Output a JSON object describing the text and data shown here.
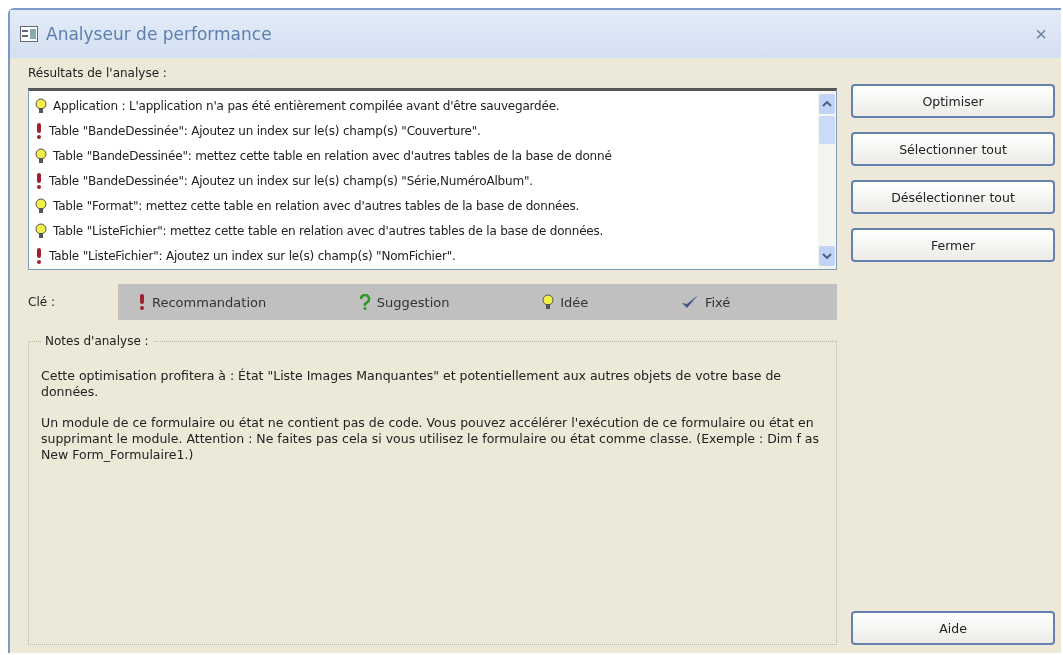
{
  "window": {
    "title": "Analyseur de performance",
    "close": "×"
  },
  "results": {
    "label": "Résultats de l'analyse :",
    "items": [
      {
        "kind": "idea",
        "text": "Application : L'application n'a pas été entièrement compilée avant d'être sauvegardée."
      },
      {
        "kind": "recommendation",
        "text": "Table \"BandeDessinée\": Ajoutez un index sur le(s) champ(s) \"Couverture\"."
      },
      {
        "kind": "idea",
        "text": "Table \"BandeDessinée\": mettez cette table en relation avec d'autres tables de la base de donné"
      },
      {
        "kind": "recommendation",
        "text": "Table \"BandeDessinée\": Ajoutez un index sur le(s) champ(s) \"Série,NuméroAlbum\"."
      },
      {
        "kind": "idea",
        "text": "Table \"Format\": mettez cette table en relation avec d'autres tables de la base de données."
      },
      {
        "kind": "idea",
        "text": "Table \"ListeFichier\": mettez cette table en relation avec d'autres tables de la base de données."
      },
      {
        "kind": "recommendation",
        "text": "Table \"ListeFichier\": Ajoutez un index sur le(s) champ(s) \"NomFichier\"."
      }
    ]
  },
  "key": {
    "label": "Clé :",
    "entries": [
      {
        "kind": "recommendation",
        "text": "Recommandation"
      },
      {
        "kind": "suggestion",
        "text": "Suggestion"
      },
      {
        "kind": "idea",
        "text": "Idée"
      },
      {
        "kind": "fixed",
        "text": "Fixé"
      }
    ]
  },
  "notes": {
    "label": "Notes d'analyse :",
    "paragraphs": [
      "Cette optimisation profitera à : État \"Liste Images Manquantes\" et potentiellement aux autres objets de votre base de données.",
      "Un module de ce formulaire ou état ne contient pas de code. Vous pouvez accélérer l'exécution de ce formulaire ou état en supprimant le module. Attention : Ne faites pas cela si vous utilisez le formulaire ou état comme classe. (Exemple : Dim f as New Form_Formulaire1.)"
    ]
  },
  "buttons": [
    "Optimiser",
    "Sélectionner tout",
    "Désélectionner tout",
    "Fermer"
  ],
  "help_button": "Aide"
}
